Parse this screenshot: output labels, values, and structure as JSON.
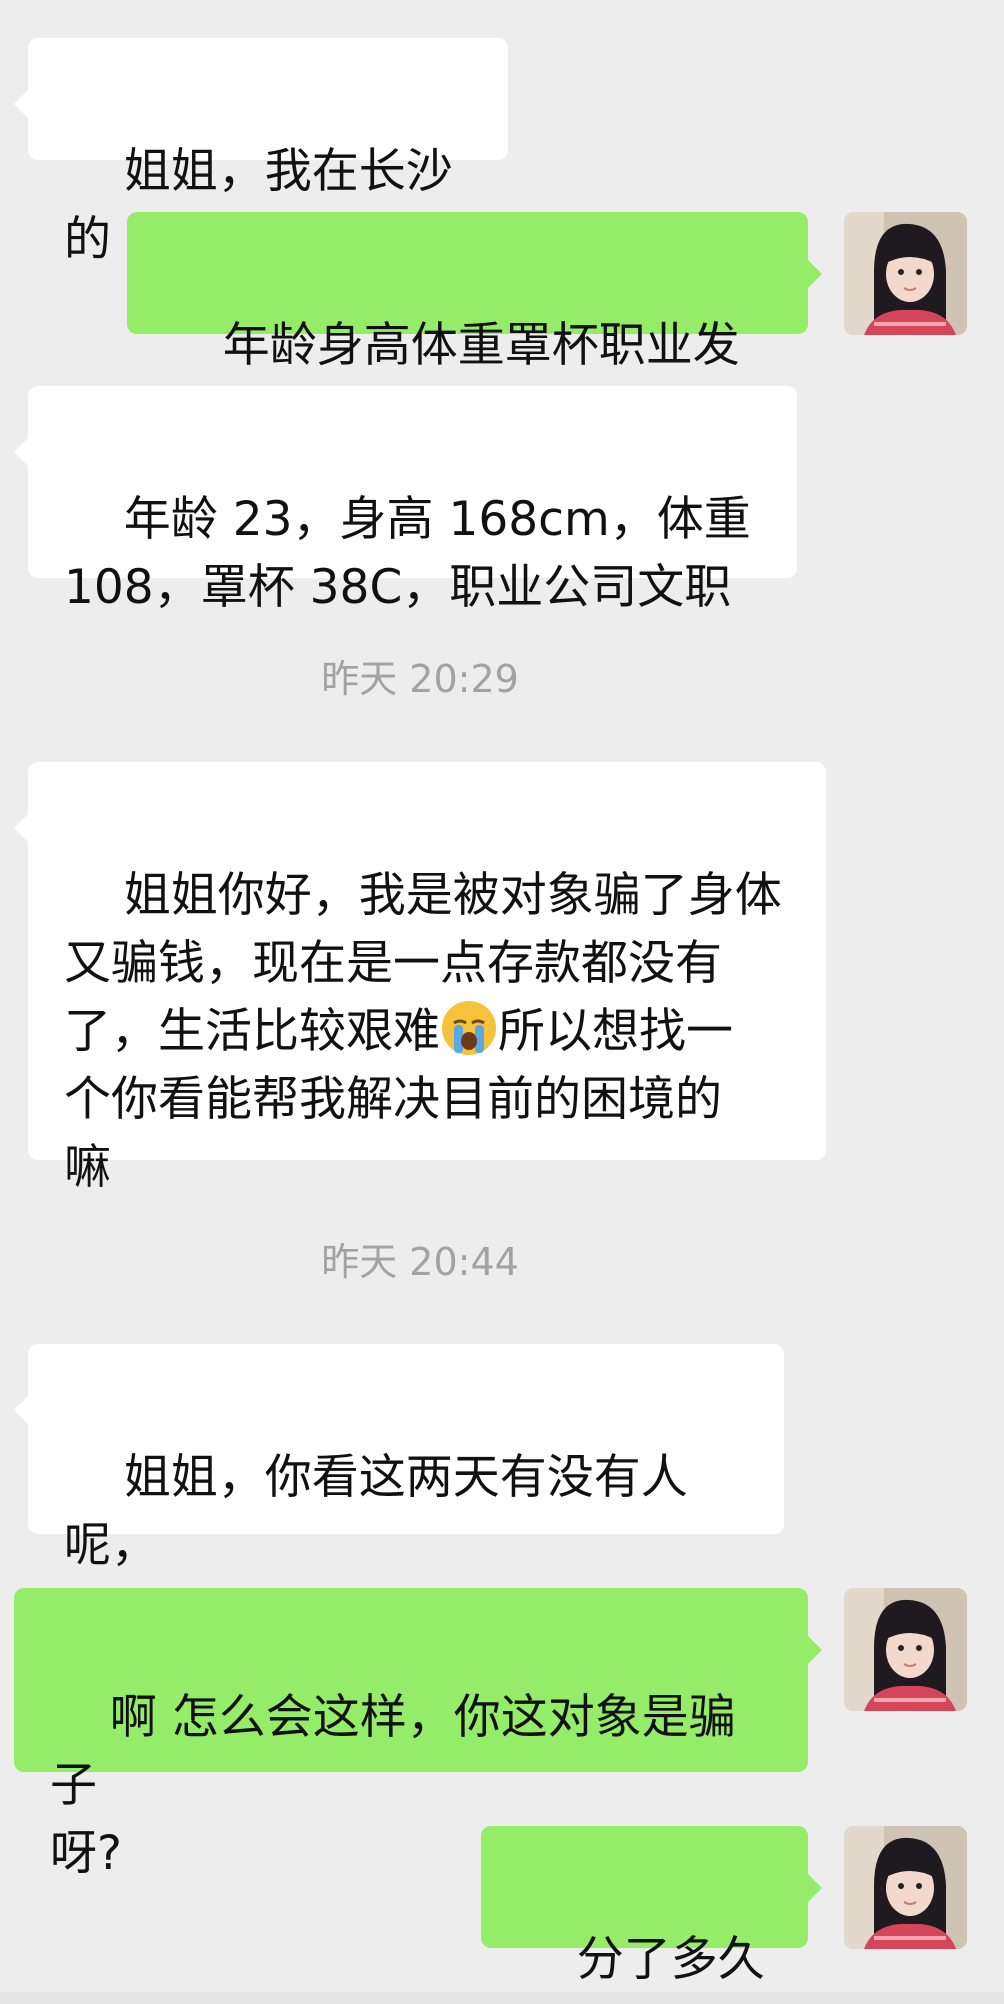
{
  "messages": {
    "m1": "姐姐，我在长沙的",
    "m2": "年龄身高体重罩杯职业发我",
    "m3": "年龄 23，身高 168cm，体重\n108，罩杯 38C，职业公司文职",
    "t1": "昨天 20:29",
    "m4_part1": "姐姐你好，我是被对象骗了身体\n又骗钱，现在是一点存款都没有\n了，生活比较艰难",
    "m4_part2": "所以想找一\n个你看能帮我解决目前的困境的\n嘛",
    "t2": "昨天 20:44",
    "m5": "姐姐，你看这两天有没有人呢，\n我要交房租啦",
    "m6": "啊 怎么会这样，你这对象是骗子\n呀?",
    "m7": "分了多久呀"
  },
  "icons": {
    "crying_emoji": "loudly-crying-face-icon",
    "avatar": "user-avatar"
  },
  "colors": {
    "background": "#ededed",
    "incoming_bubble": "#ffffff",
    "outgoing_bubble": "#95ec69",
    "timestamp": "#a2a2a2"
  }
}
